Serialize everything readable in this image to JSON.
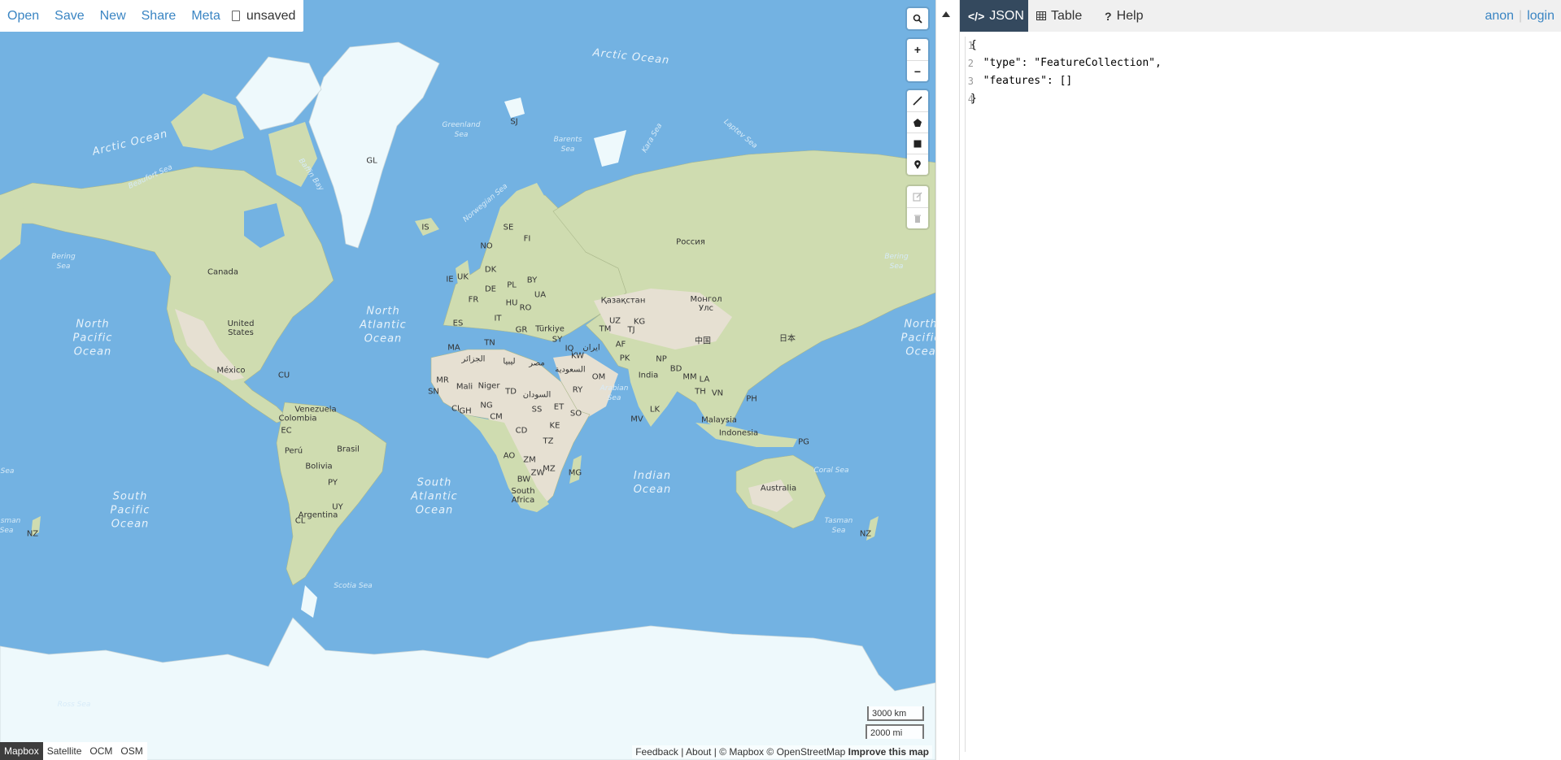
{
  "app": {
    "title": "geojson.io"
  },
  "top_menu": {
    "items": [
      "Open",
      "Save",
      "New",
      "Share",
      "Meta"
    ],
    "file_status": "unsaved"
  },
  "map": {
    "countries": [
      {
        "text": "GL"
      },
      {
        "text": "IS"
      },
      {
        "text": "SE"
      },
      {
        "text": "FI"
      },
      {
        "text": "NO"
      },
      {
        "text": "Canada"
      },
      {
        "text": "United\nStates"
      },
      {
        "text": "México"
      },
      {
        "text": "CU"
      },
      {
        "text": "Venezuela"
      },
      {
        "text": "Colombia"
      },
      {
        "text": "EC"
      },
      {
        "text": "Perú"
      },
      {
        "text": "Brasil"
      },
      {
        "text": "Bolivia"
      },
      {
        "text": "PY"
      },
      {
        "text": "UY"
      },
      {
        "text": "CL"
      },
      {
        "text": "Argentina"
      },
      {
        "text": "Россия"
      },
      {
        "text": "Қазақстан"
      },
      {
        "text": "Монгол\nУлс"
      },
      {
        "text": "中国"
      },
      {
        "text": "日本"
      },
      {
        "text": "India"
      },
      {
        "text": "Türkiye"
      },
      {
        "text": "UA"
      },
      {
        "text": "BY"
      },
      {
        "text": "PL"
      },
      {
        "text": "DE"
      },
      {
        "text": "FR"
      },
      {
        "text": "ES"
      },
      {
        "text": "IT"
      },
      {
        "text": "UK"
      },
      {
        "text": "IE"
      },
      {
        "text": "DK"
      },
      {
        "text": "HU"
      },
      {
        "text": "RO"
      },
      {
        "text": "GR"
      },
      {
        "text": "MA"
      },
      {
        "text": "الجزائر"
      },
      {
        "text": "ليبيا"
      },
      {
        "text": "مصر"
      },
      {
        "text": "MR"
      },
      {
        "text": "Mali"
      },
      {
        "text": "Niger"
      },
      {
        "text": "TD"
      },
      {
        "text": "السودان"
      },
      {
        "text": "SN"
      },
      {
        "text": "NG"
      },
      {
        "text": "GH"
      },
      {
        "text": "CI"
      },
      {
        "text": "CM"
      },
      {
        "text": "CD"
      },
      {
        "text": "AO"
      },
      {
        "text": "ZM"
      },
      {
        "text": "ZW"
      },
      {
        "text": "MZ"
      },
      {
        "text": "BW"
      },
      {
        "text": "South\nAfrica"
      },
      {
        "text": "MG"
      },
      {
        "text": "TZ"
      },
      {
        "text": "KE"
      },
      {
        "text": "ET"
      },
      {
        "text": "SO"
      },
      {
        "text": "SS"
      },
      {
        "text": "السعودية"
      },
      {
        "text": "RY"
      },
      {
        "text": "OM"
      },
      {
        "text": "ایران"
      },
      {
        "text": "AF"
      },
      {
        "text": "PK"
      },
      {
        "text": "NP"
      },
      {
        "text": "BD"
      },
      {
        "text": "MM"
      },
      {
        "text": "TH"
      },
      {
        "text": "LA"
      },
      {
        "text": "VN"
      },
      {
        "text": "PH"
      },
      {
        "text": "Malaysia"
      },
      {
        "text": "Indonesia"
      },
      {
        "text": "PG"
      },
      {
        "text": "Australia"
      },
      {
        "text": "NZ"
      },
      {
        "text": "TM"
      },
      {
        "text": "UZ"
      },
      {
        "text": "KG"
      },
      {
        "text": "TJ"
      },
      {
        "text": "KW"
      },
      {
        "text": "SY"
      },
      {
        "text": "IQ"
      },
      {
        "text": "TN"
      },
      {
        "text": "LK"
      },
      {
        "text": "MV"
      },
      {
        "text": "SJ"
      },
      {
        "text": "NZ"
      }
    ],
    "oceans": [
      {
        "text": "Arctic Ocean"
      },
      {
        "text": "Arctic Ocean"
      },
      {
        "text": "North\nAtlantic\nOcean"
      },
      {
        "text": "North\nPacific\nOcean"
      },
      {
        "text": "North\nPacific\nOcea"
      },
      {
        "text": "South\nPacific\nOcean"
      },
      {
        "text": "South\nAtlantic\nOcean"
      },
      {
        "text": "Indian\nOcean"
      }
    ],
    "seas": [
      {
        "text": "Greenland\nSea"
      },
      {
        "text": "Barents\nSea"
      },
      {
        "text": "Kara Sea"
      },
      {
        "text": "Laptev Sea"
      },
      {
        "text": "Baffin Bay"
      },
      {
        "text": "Beaufort Sea"
      },
      {
        "text": "Bering\nSea"
      },
      {
        "text": "Bering\nSea"
      },
      {
        "text": "Norwegian Sea"
      },
      {
        "text": "Arabian\nSea"
      },
      {
        "text": "Coral Sea"
      },
      {
        "text": "Tasman\nSea"
      },
      {
        "text": "Tasman\nSea"
      },
      {
        "text": "Scotia Sea"
      },
      {
        "text": "Ross Sea"
      },
      {
        "text": "Sea"
      }
    ],
    "controls": {
      "search_icon": "search-icon",
      "zoom_in": "+",
      "zoom_out": "−",
      "draw_tools": [
        "line-icon",
        "polygon-icon",
        "rectangle-icon",
        "marker-icon"
      ],
      "edit_tools": [
        "edit-icon",
        "trash-icon"
      ]
    },
    "scale": {
      "km": "3000 km",
      "mi": "2000 mi"
    },
    "layers": {
      "items": [
        "Mapbox",
        "Satellite",
        "OCM",
        "OSM"
      ],
      "active": "Mapbox"
    },
    "attribution": {
      "feedback": "Feedback",
      "about": "About",
      "mapbox": "© Mapbox",
      "osm": "© OpenStreetMap",
      "improve": "Improve this map"
    },
    "colors": {
      "water": "#73b2e2",
      "land": "#cfdcb0",
      "ice": "#eef9fc",
      "desert": "#e6e0d2"
    }
  },
  "panel": {
    "tabs": [
      {
        "label": "JSON",
        "icon": "code-icon",
        "active": true
      },
      {
        "label": "Table",
        "icon": "table-icon",
        "active": false
      },
      {
        "label": "Help",
        "icon": "question-icon",
        "active": false
      }
    ],
    "user": {
      "anon": "anon",
      "sep": "|",
      "login": "login"
    },
    "collapse_icon": "triangle-up-icon",
    "active_tab_color": "#34495e",
    "link_color": "#3a85c3"
  },
  "editor": {
    "line_numbers": [
      "1",
      "2",
      "3",
      "4"
    ],
    "lines": [
      "{",
      "  \"type\": \"FeatureCollection\",",
      "  \"features\": []",
      "}"
    ]
  }
}
